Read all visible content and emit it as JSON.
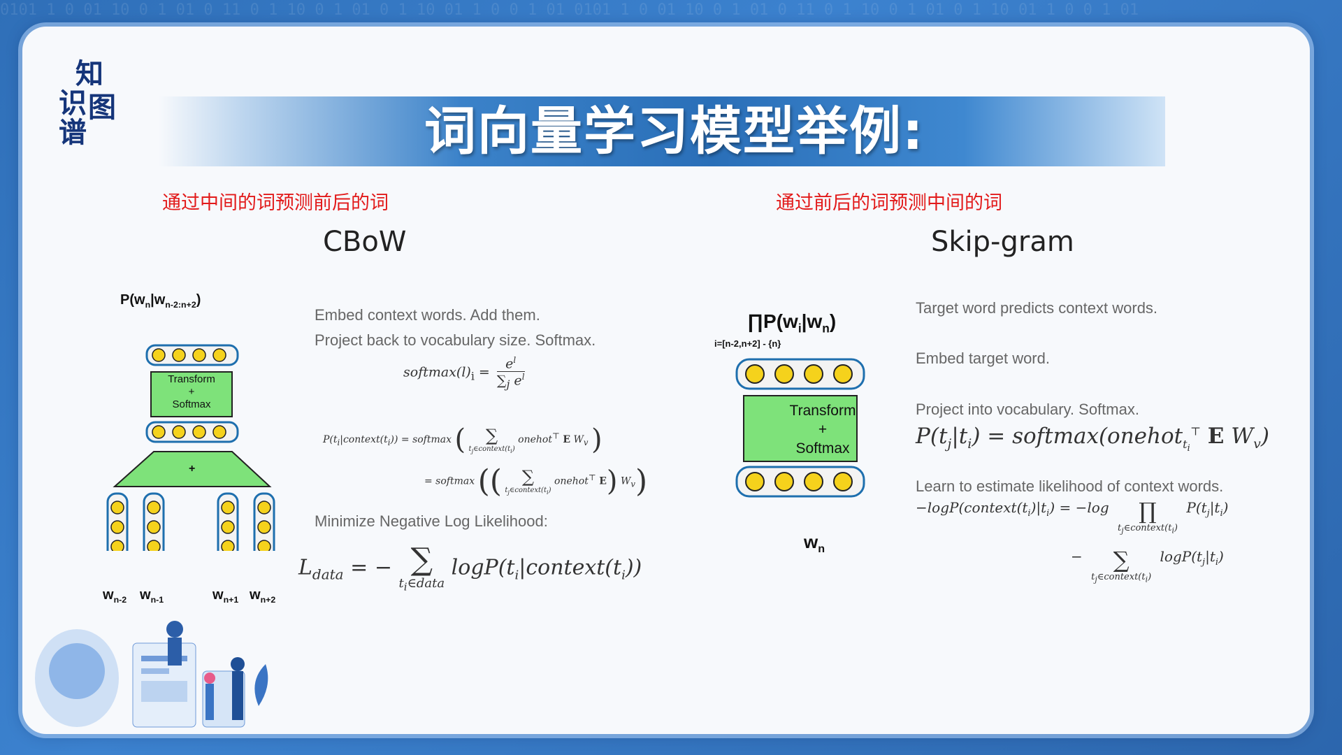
{
  "logo": {
    "chars": [
      "知",
      "识",
      "图",
      "谱"
    ]
  },
  "title": "词向量学习模型举例:",
  "cbow": {
    "red_label": "通过中间的词预测前后的词",
    "name": "CBoW",
    "diagram": {
      "top_label": "P(w",
      "top_sub": "n",
      "top_mid": "|w",
      "top_sub2": "n-2:n+2",
      "top_end": ")",
      "box_line1": "Transform",
      "box_line2": "+",
      "box_line3": "Softmax",
      "sum_label": "+",
      "word_labels": [
        {
          "w": "w",
          "sub": "n-2"
        },
        {
          "w": "w",
          "sub": "n-1"
        },
        {
          "w": "w",
          "sub": "n+1"
        },
        {
          "w": "w",
          "sub": "n+2"
        }
      ]
    },
    "desc1": "Embed context words. Add them.",
    "desc2": "Project back to vocabulary size. Softmax.",
    "desc3": "Minimize Negative Log Likelihood:",
    "formula_softmax_lhs": "softmax(l)",
    "formula_softmax_sub": "i",
    "formula_softmax_num": "e",
    "formula_softmax_num_sup": "l",
    "formula_softmax_den": "∑",
    "formula_p_lhs": "P(t",
    "formula_p_rest": "|context(t",
    "formula_p_end": ")) = softmax",
    "formula_sum_under": "t",
    "formula_sum_under2": "∈context(t",
    "formula_onehot": "onehot",
    "formula_E": "E",
    "formula_W": "W",
    "formula_eq2": "= softmax",
    "formula_L": "L",
    "formula_L_sub": "data",
    "formula_L_eq": "= −",
    "formula_L_under": "t",
    "formula_L_under2": "∈data",
    "formula_L_rest": "logP(t",
    "formula_L_rest2": "|context(t",
    "formula_L_end": "))"
  },
  "skipgram": {
    "red_label": "通过前后的词预测中间的词",
    "name": "Skip-gram",
    "diagram": {
      "top_label": "∏P(w",
      "top_sub": "i",
      "top_mid": "|w",
      "top_sub2": "n",
      "top_end": ")",
      "top_under": "i=[n-2,n+2] - {n}",
      "box_line1": "Transform",
      "box_line2": "+",
      "box_line3": "Softmax",
      "bottom_w": "w",
      "bottom_sub": "n"
    },
    "desc1": "Target word predicts context words.",
    "desc2": "Embed target word.",
    "desc3": "Project into vocabulary. Softmax.",
    "desc4": "Learn to estimate likelihood of context words.",
    "formula_p": "P(t",
    "formula_p2": "|t",
    "formula_p3": ") = softmax(onehot",
    "formula_p4": "E",
    "formula_p5": "W",
    "formula_p6": ")",
    "formula_nll": "−logP(context(t",
    "formula_nll2": ")|t",
    "formula_nll3": ") = −log",
    "formula_prod": "∏",
    "formula_under": "t",
    "formula_under2": "∈context(t",
    "formula_rhs": "P(t",
    "formula_rhs2": "|t",
    "formula_minus": "−",
    "formula_sum": "∑",
    "formula_rhs3": "logP(t"
  },
  "colors": {
    "accent_red": "#e21a1a",
    "box_green": "#7ee27a",
    "node_yellow": "#f5d21c",
    "node_outline": "#1e6fae",
    "trapezoid_green": "#7ee27a"
  }
}
